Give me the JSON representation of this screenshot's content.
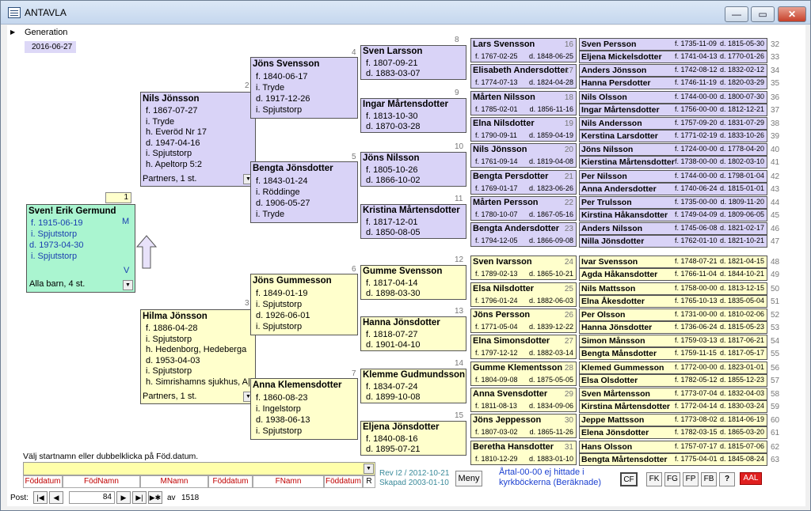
{
  "window": {
    "title": "ANTAVLA",
    "min": "—",
    "max": "▭",
    "close": "✕"
  },
  "generation": {
    "label": "Generation",
    "date": "2016-06-27"
  },
  "root": {
    "num": "1",
    "name": "Sven! Erik Germund",
    "born": "f. 1915-06-19",
    "bplace": "i.  Spjutstorp",
    "died": "d. 1973-04-30",
    "dplace": "i. Spjutstorp",
    "sex_m": "M",
    "sex_v": "V",
    "children": "Alla barn, 4 st."
  },
  "g2": [
    {
      "num": "2",
      "name": "Nils Jönsson",
      "lines": [
        "f. 1867-07-27",
        "i. Tryde",
        "h. Everöd Nr 17",
        "d. 1947-04-16",
        "i. Spjutstorp",
        "h. Apeltorp 5:2"
      ],
      "partners": "Partners, 1 st."
    },
    {
      "num": "3",
      "name": "Hilma Jönsson",
      "lines": [
        "f. 1886-04-28",
        "i. Spjutstorp",
        "h. Hedenborg, Hedeberga",
        "d. 1953-04-03",
        "i. Spjutstorp",
        "h. Simrishamns sjukhus, A|"
      ],
      "partners": "Partners, 1 st."
    }
  ],
  "g3": [
    {
      "num": "4",
      "name": "Jöns Svensson",
      "lines": [
        "f. 1840-06-17",
        "i. Tryde",
        "d. 1917-12-26",
        "i. Spjutstorp"
      ]
    },
    {
      "num": "5",
      "name": "Bengta Jönsdotter",
      "lines": [
        "f. 1843-01-24",
        "i. Röddinge",
        "d. 1906-05-27",
        "i. Tryde"
      ]
    },
    {
      "num": "6",
      "name": "Jöns Gummesson",
      "lines": [
        "f. 1849-01-19",
        "i. Spjutstorp",
        "d. 1926-06-01",
        "i. Spjutstorp"
      ]
    },
    {
      "num": "7",
      "name": "Anna Klemensdotter",
      "lines": [
        "f. 1860-08-23",
        "i. Ingelstorp",
        "d. 1938-06-13",
        "i. Spjutstorp"
      ]
    }
  ],
  "g4": [
    {
      "num": "8",
      "name": "Sven Larsson",
      "b": "f. 1807-09-21",
      "d": "d. 1883-03-07"
    },
    {
      "num": "9",
      "name": "Ingar Mårtensdotter",
      "b": "f. 1813-10-30",
      "d": "d. 1870-03-28"
    },
    {
      "num": "10",
      "name": "Jöns Nilsson",
      "b": "f. 1805-10-26",
      "d": "d. 1866-10-02"
    },
    {
      "num": "11",
      "name": "Kristina Mårtensdotter",
      "b": "f. 1817-12-01",
      "d": "d. 1850-08-05"
    },
    {
      "num": "12",
      "name": "Gumme Svensson",
      "b": "f. 1817-04-14",
      "d": "d. 1898-03-30"
    },
    {
      "num": "13",
      "name": "Hanna Jönsdotter",
      "b": "f. 1818-07-27",
      "d": "d. 1901-04-10"
    },
    {
      "num": "14",
      "name": "Klemme Gudmundsson",
      "b": "f. 1834-07-24",
      "d": "d. 1899-10-08"
    },
    {
      "num": "15",
      "name": "Eljena Jönsdotter",
      "b": "f. 1840-08-16",
      "d": "d. 1895-07-21"
    }
  ],
  "g5": [
    {
      "num": "16",
      "name": "Lars Svensson",
      "b": "f. 1767-02-25",
      "d": "d. 1848-06-25"
    },
    {
      "num": "17",
      "name": "Elisabeth Andersdotter",
      "b": "f. 1774-07-13",
      "d": "d. 1824-04-28"
    },
    {
      "num": "18",
      "name": "Mårten Nilsson",
      "b": "f. 1785-02-01",
      "d": "d. 1856-11-16"
    },
    {
      "num": "19",
      "name": "Elna Nilsdotter",
      "b": "f. 1790-09-11",
      "d": "d. 1859-04-19"
    },
    {
      "num": "20",
      "name": "Nils Jönsson",
      "b": "f. 1761-09-14",
      "d": "d. 1819-04-08"
    },
    {
      "num": "21",
      "name": "Bengta Persdotter",
      "b": "f. 1769-01-17",
      "d": "d. 1823-06-26"
    },
    {
      "num": "22",
      "name": "Mårten Persson",
      "b": "f. 1780-10-07",
      "d": "d. 1867-05-16"
    },
    {
      "num": "23",
      "name": "Bengta Andersdotter",
      "b": "f. 1794-12-05",
      "d": "d. 1866-09-08"
    },
    {
      "num": "24",
      "name": "Sven Ivarsson",
      "b": "f. 1789-02-13",
      "d": "d. 1865-10-21"
    },
    {
      "num": "25",
      "name": "Elsa Nilsdotter",
      "b": "f. 1796-01-24",
      "d": "d. 1882-06-03"
    },
    {
      "num": "26",
      "name": "Jöns Persson",
      "b": "f. 1771-05-04",
      "d": "d. 1839-12-22"
    },
    {
      "num": "27",
      "name": "Elna Simonsdotter",
      "b": "f. 1797-12-12",
      "d": "d. 1882-03-14"
    },
    {
      "num": "28",
      "name": "Gumme Klementsson",
      "b": "f. 1804-09-08",
      "d": "d. 1875-05-05"
    },
    {
      "num": "29",
      "name": "Anna Svensdotter",
      "b": "f. 1811-08-13",
      "d": "d. 1834-09-06"
    },
    {
      "num": "30",
      "name": "Jöns Jeppesson",
      "b": "f. 1807-03-02",
      "d": "d. 1865-11-26"
    },
    {
      "num": "31",
      "name": "Beretha Hansdotter",
      "b": "f. 1810-12-29",
      "d": "d. 1883-01-10"
    }
  ],
  "g6": [
    {
      "num": "32",
      "name": "Sven Persson",
      "b": "f. 1735-11-09",
      "d": "d. 1815-05-30"
    },
    {
      "num": "33",
      "name": "Eljena Mickelsdotter",
      "b": "f. 1741-04-13",
      "d": "d. 1770-01-26"
    },
    {
      "num": "34",
      "name": "Anders Jönsson",
      "b": "f. 1742-08-12",
      "d": "d. 1832-02-12"
    },
    {
      "num": "35",
      "name": "Hanna Persdotter",
      "b": "f. 1746-11-19",
      "d": "d. 1820-03-29"
    },
    {
      "num": "36",
      "name": "Nils Olsson",
      "b": "f. 1744-00-00",
      "d": "d. 1800-07-30"
    },
    {
      "num": "37",
      "name": "Ingar Mårtensdotter",
      "b": "f. 1756-00-00",
      "d": "d. 1812-12-21"
    },
    {
      "num": "38",
      "name": "Nils Andersson",
      "b": "f. 1757-09-20",
      "d": "d. 1831-07-29"
    },
    {
      "num": "39",
      "name": "Kerstina Larsdotter",
      "b": "f. 1771-02-19",
      "d": "d. 1833-10-26"
    },
    {
      "num": "40",
      "name": "Jöns Nilsson",
      "b": "f. 1724-00-00",
      "d": "d. 1778-04-20"
    },
    {
      "num": "41",
      "name": "Kierstina Mårtensdotter",
      "b": "f. 1738-00-00",
      "d": "d. 1802-03-10"
    },
    {
      "num": "42",
      "name": "Per Nilsson",
      "b": "f. 1744-00-00",
      "d": "d. 1798-01-04"
    },
    {
      "num": "43",
      "name": "Anna Andersdotter",
      "b": "f. 1740-06-24",
      "d": "d. 1815-01-01"
    },
    {
      "num": "44",
      "name": "Per Trulsson",
      "b": "f. 1735-00-00",
      "d": "d. 1809-11-20"
    },
    {
      "num": "45",
      "name": "Kirstina Håkansdotter",
      "b": "f. 1749-04-09",
      "d": "d. 1809-06-05"
    },
    {
      "num": "46",
      "name": "Anders Nilsson",
      "b": "f. 1745-06-08",
      "d": "d. 1821-02-17"
    },
    {
      "num": "47",
      "name": "Nilla Jönsdotter",
      "b": "f. 1762-01-10",
      "d": "d. 1821-10-21"
    },
    {
      "num": "48",
      "name": "Ivar Svensson",
      "b": "f. 1748-07-21",
      "d": "d. 1821-04-15"
    },
    {
      "num": "49",
      "name": "Agda Håkansdotter",
      "b": "f. 1766-11-04",
      "d": "d. 1844-10-21"
    },
    {
      "num": "50",
      "name": "Nils Mattsson",
      "b": "f. 1758-00-00",
      "d": "d. 1813-12-15"
    },
    {
      "num": "51",
      "name": "Elna Åkesdotter",
      "b": "f. 1765-10-13",
      "d": "d. 1835-05-04"
    },
    {
      "num": "52",
      "name": "Per Olsson",
      "b": "f. 1731-00-00",
      "d": "d. 1810-02-06"
    },
    {
      "num": "53",
      "name": "Hanna Jönsdotter",
      "b": "f. 1736-06-24",
      "d": "d. 1815-05-23"
    },
    {
      "num": "54",
      "name": "Simon Månsson",
      "b": "f. 1759-03-13",
      "d": "d. 1817-06-21"
    },
    {
      "num": "55",
      "name": "Bengta Månsdotter",
      "b": "f. 1759-11-15",
      "d": "d. 1817-05-17"
    },
    {
      "num": "56",
      "name": "Klemed Gummesson",
      "b": "f. 1772-00-00",
      "d": "d. 1823-01-01"
    },
    {
      "num": "57",
      "name": "Elsa Olsdotter",
      "b": "f. 1782-05-12",
      "d": "d. 1855-12-23"
    },
    {
      "num": "58",
      "name": "Sven Mårtensson",
      "b": "f. 1773-07-04",
      "d": "d. 1832-04-03"
    },
    {
      "num": "59",
      "name": "Kirstina Mårtensdotter",
      "b": "f. 1772-04-14",
      "d": "d. 1830-03-24"
    },
    {
      "num": "60",
      "name": "Jeppe Mattsson",
      "b": "f. 1773-08-02",
      "d": "d. 1814-06-19"
    },
    {
      "num": "61",
      "name": "Elena Jönsdotter",
      "b": "f. 1782-03-15",
      "d": "d. 1865-03-20"
    },
    {
      "num": "62",
      "name": "Hans Olsson",
      "b": "f. 1757-07-17",
      "d": "d. 1815-07-06"
    },
    {
      "num": "63",
      "name": "Bengta Mårtensdotter",
      "b": "f. 1775-04-01",
      "d": "d. 1845-08-24"
    }
  ],
  "bottom": {
    "hint": "Välj startnamn eller dubbelklicka på Föd.datum.",
    "headers": [
      "Föddatum",
      "FödNamn",
      "MNamn",
      "Föddatum",
      "FNamn",
      "Föddatum",
      "R"
    ],
    "rev": "Rev I2 / 2012-10-21",
    "created": "Skapad 2003-01-10",
    "menu": "Meny",
    "note1": "Årtal-00-00 ej hittade i",
    "note2": "kyrkböckerna (Beräknade)",
    "cf": "CF",
    "fk": "FK",
    "fg": "FG",
    "fp": "FP",
    "fb": "FB",
    "help": "?",
    "aal": "AAL",
    "post_label": "Post:",
    "record": "84",
    "of": "av",
    "total": "1518"
  }
}
